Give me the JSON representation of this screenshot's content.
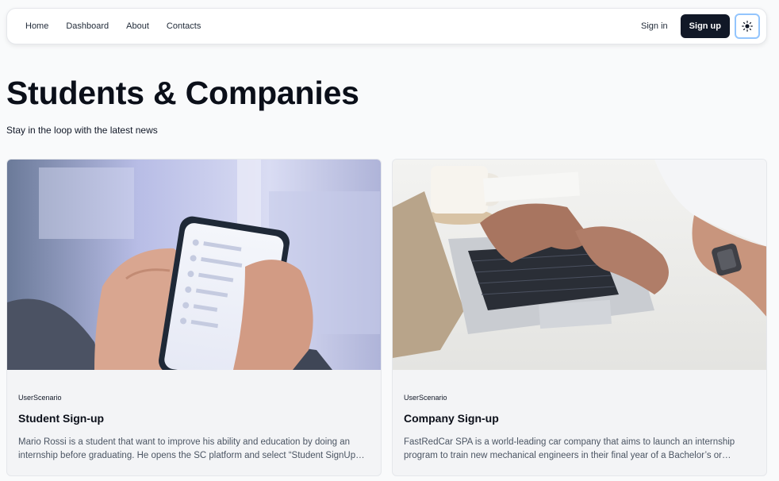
{
  "nav": {
    "links": [
      "Home",
      "Dashboard",
      "About",
      "Contacts"
    ],
    "signin_label": "Sign in",
    "signup_label": "Sign up",
    "theme_icon": "sun-icon"
  },
  "header": {
    "title": "Students & Companies",
    "subtitle": "Stay in the loop with the latest news"
  },
  "cards": [
    {
      "tag": "UserScenario",
      "title": "Student Sign-up",
      "description": "Mario Rossi is a student that want to improve his ability and education by doing an internship before graduating. He opens the SC platform and select “Student SignUp…",
      "image": "phone-in-hands-photo"
    },
    {
      "tag": "UserScenario",
      "title": "Company Sign-up",
      "description": "FastRedCar SPA is a world-leading car company that aims to launch an internship program to train new mechanical engineers in their final year of a Bachelor’s or…",
      "image": "laptop-typing-photo"
    }
  ],
  "colors": {
    "background": "#f9fafb",
    "primary_button": "#111827",
    "card_background": "#f3f4f6",
    "focus_ring": "#93c5fd"
  }
}
